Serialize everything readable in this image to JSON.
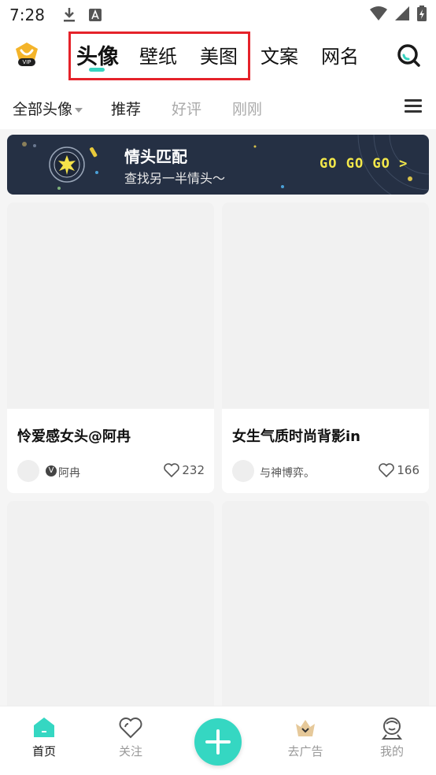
{
  "status_bar": {
    "time": "7:28"
  },
  "top_nav": {
    "tabs": [
      {
        "label": "头像",
        "active": true
      },
      {
        "label": "壁纸"
      },
      {
        "label": "美图"
      },
      {
        "label": "文案"
      },
      {
        "label": "网名"
      }
    ],
    "vip_label": "VIP",
    "accent_color": "#37d4c0",
    "highlight_color": "#e5222a"
  },
  "sub_nav": {
    "items": [
      "全部头像",
      "推荐",
      "好评",
      "刚刚"
    ]
  },
  "banner": {
    "title": "情头匹配",
    "subtitle": "查找另一半情头～",
    "cta": "GO GO GO >"
  },
  "cards": [
    {
      "title": "怜爱感女头@阿冉",
      "author": "阿冉",
      "verified": true,
      "likes": "232"
    },
    {
      "title": "女生气质时尚背影in",
      "author": "与神博弈。",
      "verified": false,
      "likes": "166"
    }
  ],
  "bottom_nav": {
    "items": [
      {
        "label": "首页",
        "active": true
      },
      {
        "label": "关注"
      },
      {
        "label": "去广告"
      },
      {
        "label": "我的"
      }
    ]
  }
}
